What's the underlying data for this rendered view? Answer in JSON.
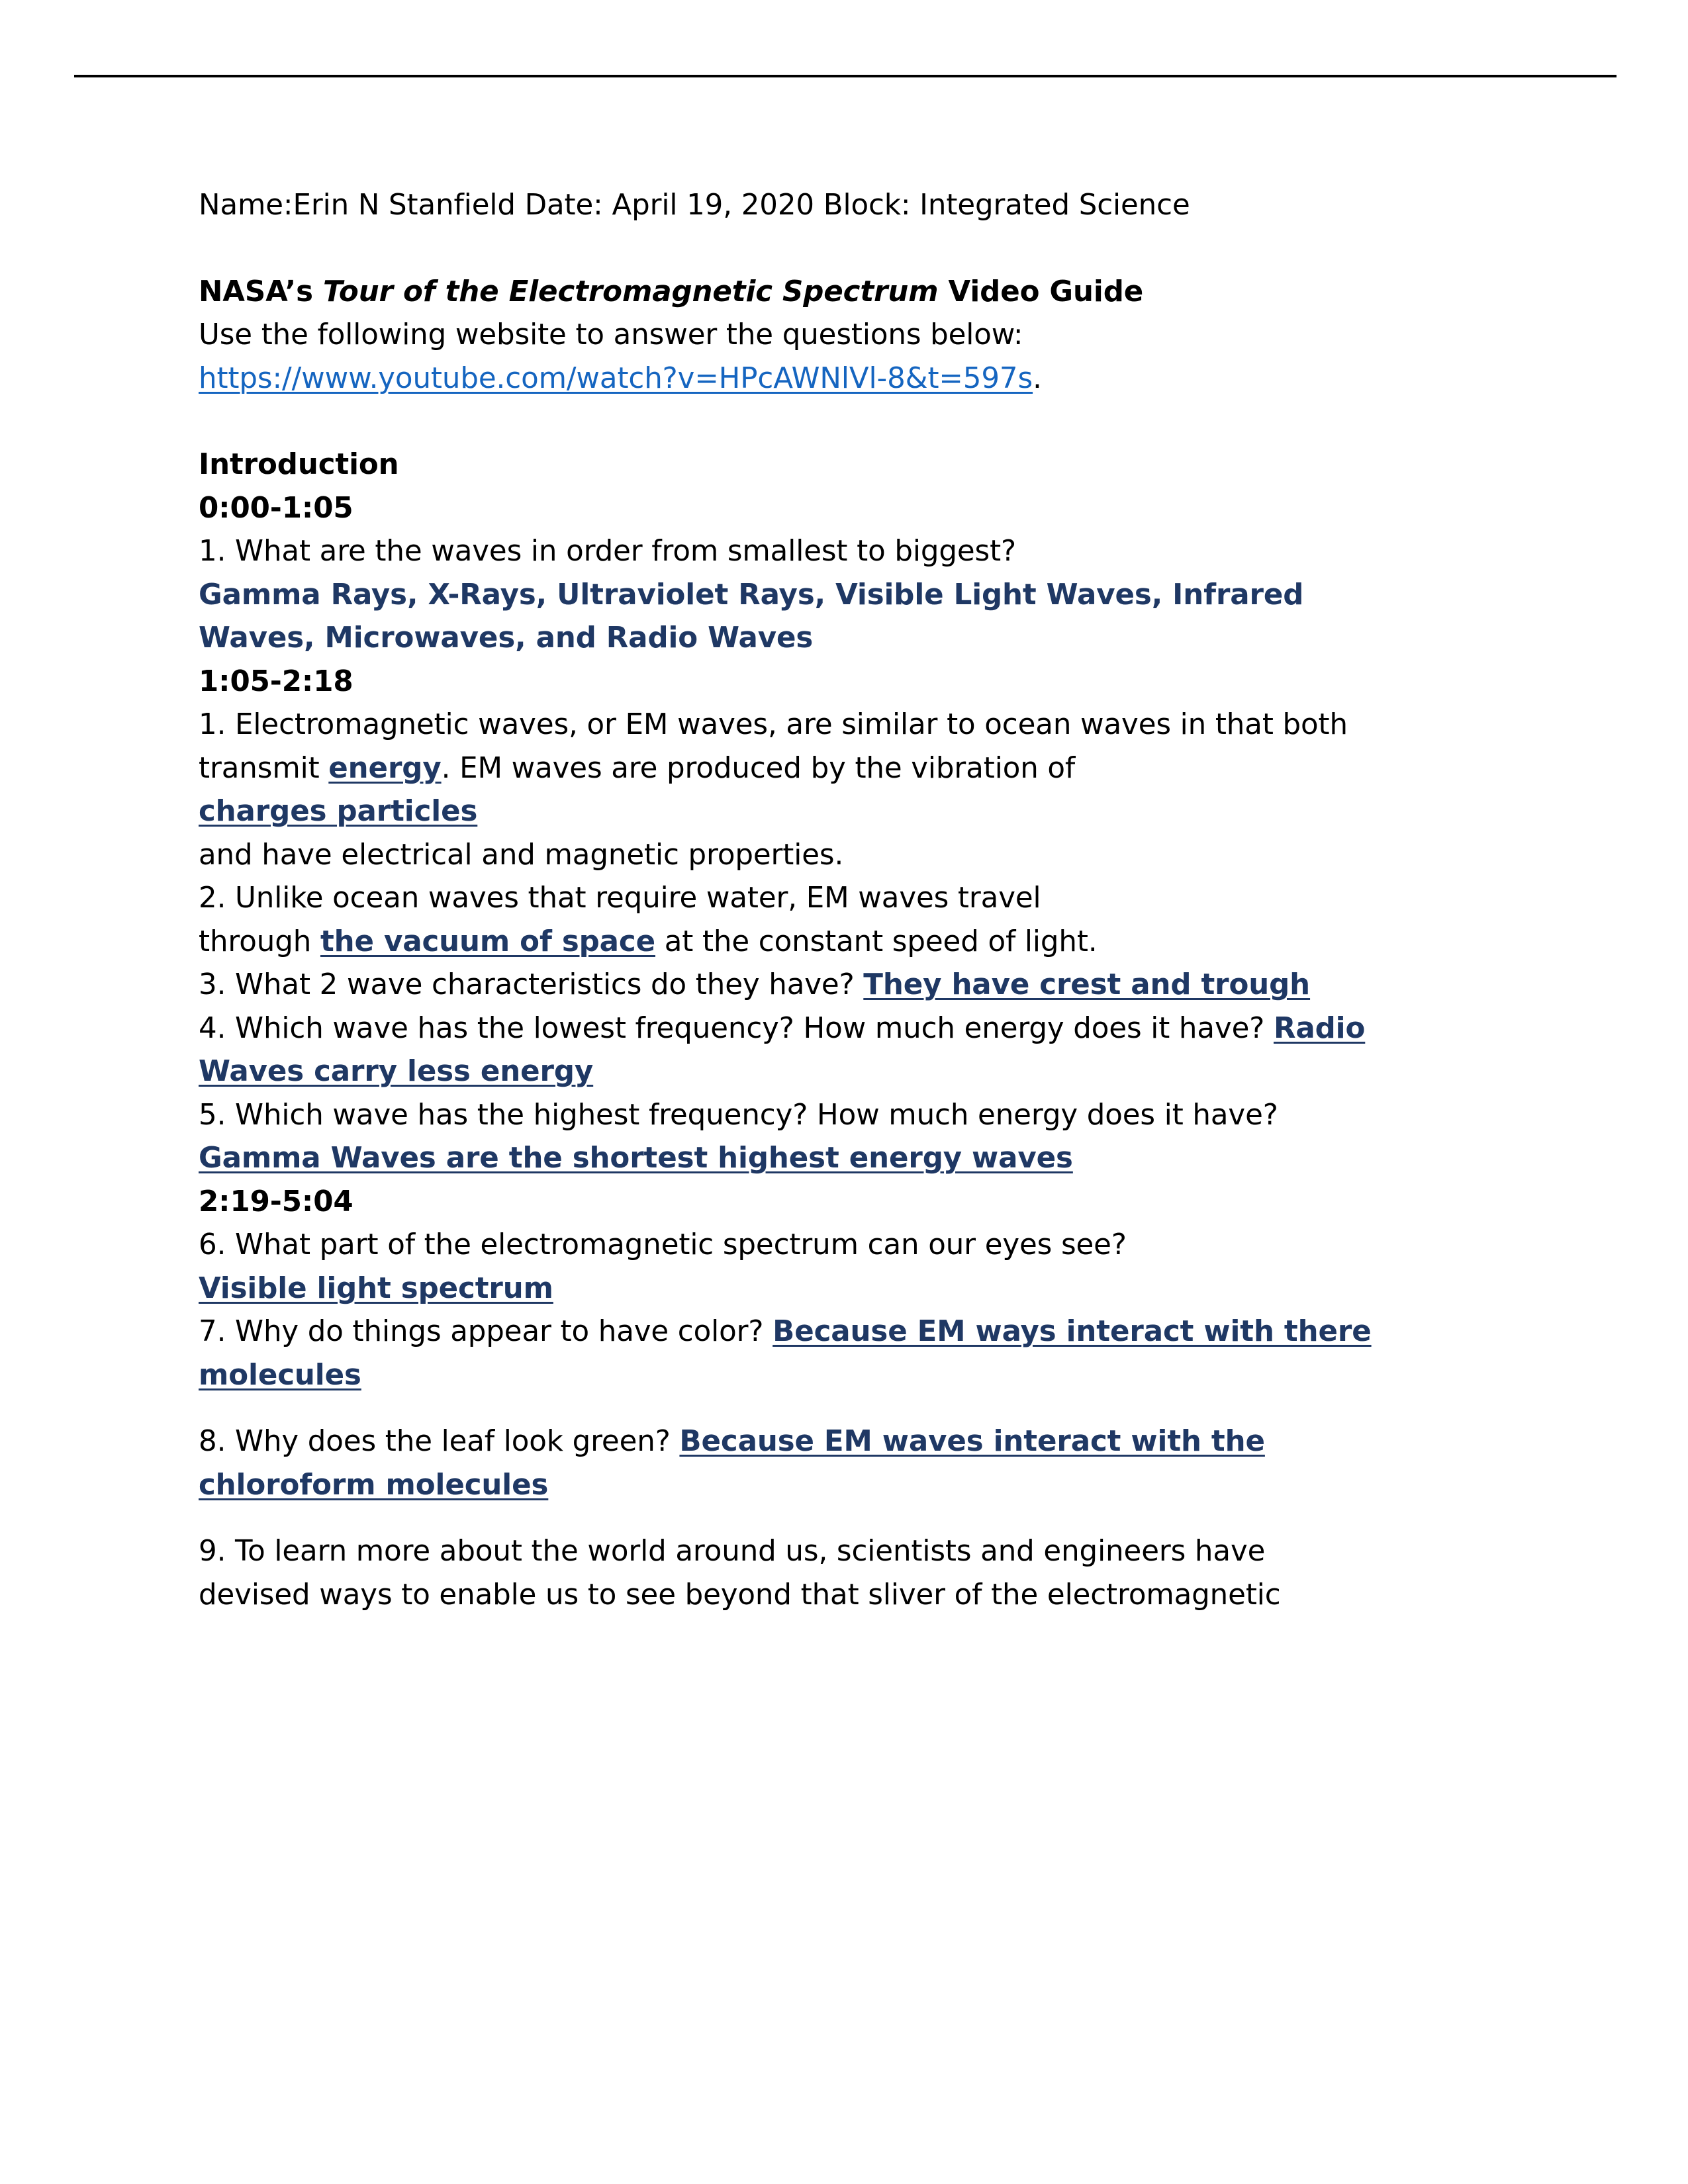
{
  "document": {
    "header_rule": true,
    "colors": {
      "answer_navy": "#1F3864",
      "hyperlink_blue": "#1565C0",
      "body_text": "#000000"
    },
    "heading_line": {
      "name_label": "Name:",
      "student_name": "Erin N Stanfield",
      "date_label": " Date: ",
      "date_value": "April 19, 2020",
      "block_label": " Block: ",
      "block_value": "Integrated Science",
      "full_text": "Name:Erin N Stanfield Date: April 19, 2020 Block: Integrated Science"
    },
    "title": {
      "prefix": "NASA’s ",
      "italic_part": "Tour of the Electromagnetic Spectrum",
      "suffix": " Video Guide"
    },
    "instruction": "Use the following website to answer the questions below:",
    "url": {
      "text": "https://www.youtube.com/watch?v=HPcAWNlVl-8&t=597s",
      "trailing_punctuation": "."
    },
    "sections": [
      {
        "heading": "Introduction",
        "timestamps": [
          {
            "label": "0:00-1:05",
            "items": [
              {
                "number": "1.",
                "question": " What are the waves in order from smallest to biggest?",
                "answer_on_new_line": true,
                "answer": "Gamma Rays, X-Rays, Ultraviolet Rays, Visible Light Waves, Infrared Waves, Microwaves, and Radio Waves",
                "answer_underlined": false
              }
            ]
          },
          {
            "label": "1:05-2:18",
            "items": [
              {
                "number": "1.",
                "pre_text": " Electromagnetic waves, or EM waves, are similar to ocean waves in that both",
                "line2_pre": "transmit ",
                "blank1": "energy",
                "line2_post": ". EM waves are produced by the vibration of ",
                "blank2": "charges particles",
                "line3": "and have electrical and magnetic properties."
              },
              {
                "number": "2.",
                "pre_text": " Unlike ocean waves that require water, EM waves travel",
                "line2_pre": "through ",
                "blank1": "the vacuum of space",
                "line2_post": " at the constant speed of light."
              },
              {
                "number": "3.",
                "question": " What 2 wave characteristics do they have? ",
                "answer": "They have crest and trough"
              },
              {
                "number": "4.",
                "question": " Which wave has the lowest frequency? How much energy does it have? ",
                "answer": "Radio Waves carry less energy"
              },
              {
                "number": "5.",
                "question": " Which wave has the highest frequency? How much energy does it have? ",
                "answer": "Gamma Waves are the shortest highest energy waves"
              }
            ]
          },
          {
            "label": "2:19-5:04",
            "items": [
              {
                "number": "6.",
                "question": " What part of the electromagnetic spectrum can our eyes see?",
                "answer_on_new_line": true,
                "answer": "Visible light spectrum"
              },
              {
                "number": "7.",
                "question": " Why do things appear to have color? ",
                "answer": "Because EM ways interact with there molecules "
              },
              {
                "number": "8.",
                "question": " Why does the leaf look green? ",
                "answer": "Because EM waves interact with the chloroform molecules"
              },
              {
                "number": "9.",
                "line1": " To learn more about the world around us, scientists and engineers have",
                "line2": "devised ways to enable us to see beyond that sliver of the electromagnetic"
              }
            ]
          }
        ]
      }
    ]
  }
}
